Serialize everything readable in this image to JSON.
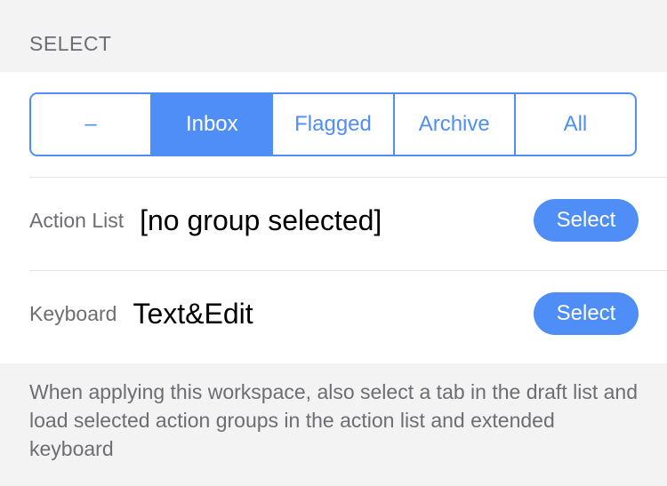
{
  "section": {
    "header": "SELECT"
  },
  "tabs": [
    {
      "label": "–",
      "selected": false
    },
    {
      "label": "Inbox",
      "selected": true
    },
    {
      "label": "Flagged",
      "selected": false
    },
    {
      "label": "Archive",
      "selected": false
    },
    {
      "label": "All",
      "selected": false
    }
  ],
  "action_list": {
    "label": "Action List",
    "value": "[no group selected]",
    "button": "Select"
  },
  "keyboard": {
    "label": "Keyboard",
    "value": "Text&Edit",
    "button": "Select"
  },
  "footer": {
    "text": "When applying this workspace, also select a tab in the draft list and load selected action groups in the action list and extended keyboard"
  },
  "colors": {
    "accent": "#4f8ef7",
    "background": "#f3f3f3",
    "card": "#ffffff",
    "secondary_text": "#6d6d72"
  }
}
